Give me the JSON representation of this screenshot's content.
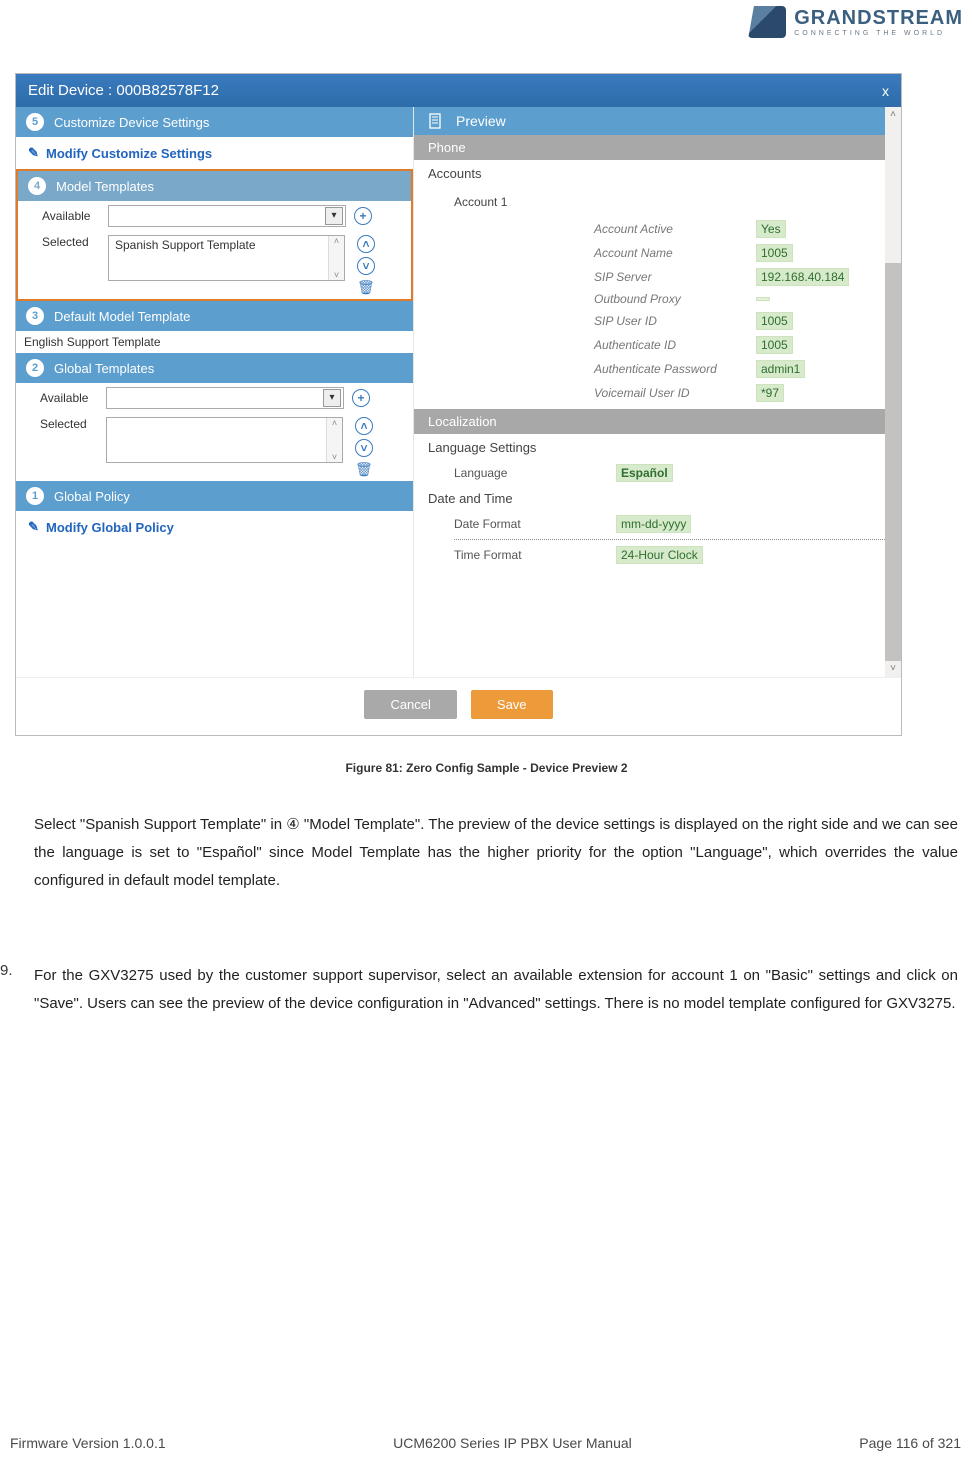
{
  "logo": {
    "brand": "GRANDSTREAM",
    "tagline": "CONNECTING THE WORLD"
  },
  "dialog": {
    "title": "Edit Device : 000B82578F12",
    "close": "x"
  },
  "sections": {
    "s5": "Customize Device Settings",
    "modify5": "Modify Customize Settings",
    "s4": "Model Templates",
    "available_label": "Available",
    "selected_label": "Selected",
    "selected_value": "Spanish Support Template",
    "s3": "Default Model Template",
    "s3_text": "English Support Template",
    "s2": "Global Templates",
    "s1": "Global Policy",
    "modify1": "Modify Global Policy"
  },
  "preview": {
    "header": "Preview",
    "phone": "Phone",
    "accounts": "Accounts",
    "account1": "Account 1",
    "fields": {
      "active_k": "Account Active",
      "active_v": "Yes",
      "name_k": "Account Name",
      "name_v": "1005",
      "sip_k": "SIP Server",
      "sip_v": "192.168.40.184",
      "proxy_k": "Outbound Proxy",
      "uid_k": "SIP User ID",
      "uid_v": "1005",
      "auth_k": "Authenticate ID",
      "auth_v": "1005",
      "pass_k": "Authenticate Password",
      "pass_v": "admin1",
      "vm_k": "Voicemail User ID",
      "vm_v": "*97"
    },
    "localization": "Localization",
    "lang_settings": "Language Settings",
    "language_k": "Language",
    "language_v": "Español",
    "datetime": "Date and Time",
    "datefmt_k": "Date Format",
    "datefmt_v": "mm-dd-yyyy",
    "timefmt_k": "Time Format",
    "timefmt_v": "24-Hour Clock"
  },
  "buttons": {
    "cancel": "Cancel",
    "save": "Save"
  },
  "caption": "Figure 81: Zero Config Sample - Device Preview 2",
  "para1": "Select \"Spanish Support Template\" in ④ \"Model Template\". The preview of the device settings is displayed on the right side and we can see the language is set to \"Español\" since Model Template has the higher priority for the option \"Language\", which overrides the value configured in default model template.",
  "list_num": "9.",
  "para2": "For the GXV3275 used by the customer support supervisor, select an available extension for account 1 on \"Basic\" settings and click on \"Save\". Users can see the preview of the device configuration in \"Advanced\" settings. There is no model template configured for GXV3275.",
  "footer": {
    "left": "Firmware Version 1.0.0.1",
    "center": "UCM6200 Series IP PBX User Manual",
    "right": "Page 116 of 321"
  }
}
